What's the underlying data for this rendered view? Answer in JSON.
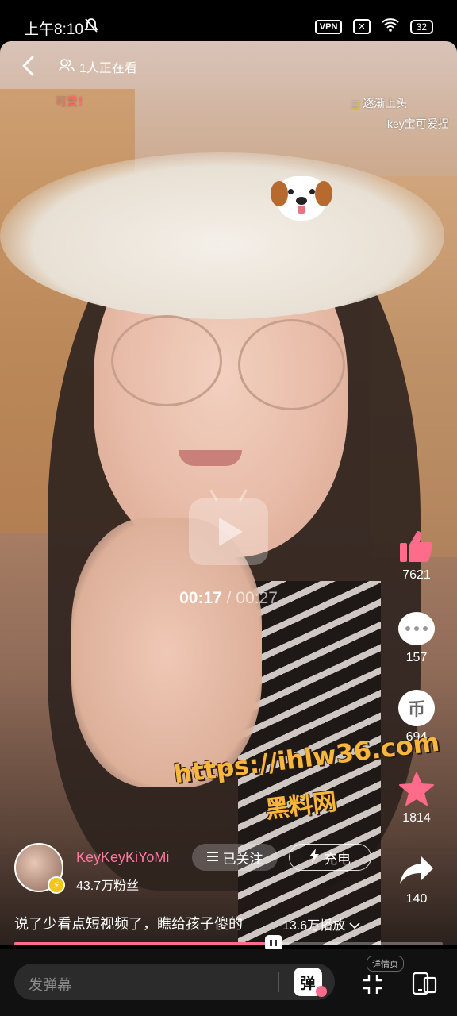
{
  "status_bar": {
    "time": "上午8:10",
    "vpn": "VPN",
    "battery": "32"
  },
  "header": {
    "viewers": "1人正在看"
  },
  "danmaku": [
    {
      "text": "可爱！",
      "color": "#ff6b6b"
    },
    {
      "text": "逐渐上头",
      "color": "#ffffff"
    },
    {
      "text": "key宝可爱捏",
      "color": "#ffffff"
    }
  ],
  "player": {
    "current_time": "00:17",
    "separator": "/",
    "total_time": "00:27",
    "progress": 0.605
  },
  "actions": {
    "likes": "7621",
    "comments": "157",
    "coins": "694",
    "favorites": "1814",
    "shares": "140"
  },
  "watermark": {
    "line1": "https://ihlw36.com",
    "line2": "黑料网"
  },
  "author": {
    "name": "KeyKeyKiYoMi",
    "fans": "43.7万粉丝",
    "follow_label": "已关注",
    "charge_label": "充电"
  },
  "video_info": {
    "caption": "说了少看点短视频了，瞧给孩子傻的",
    "plays": "13.6万播放"
  },
  "bottom_bar": {
    "danmaku_placeholder": "发弹幕",
    "danmaku_toggle": "弹",
    "detail_label": "详情页"
  },
  "colors": {
    "accent_pink": "#ff6b8b",
    "name_pink": "#ff7aa2",
    "watermark": "#f7b73c"
  }
}
